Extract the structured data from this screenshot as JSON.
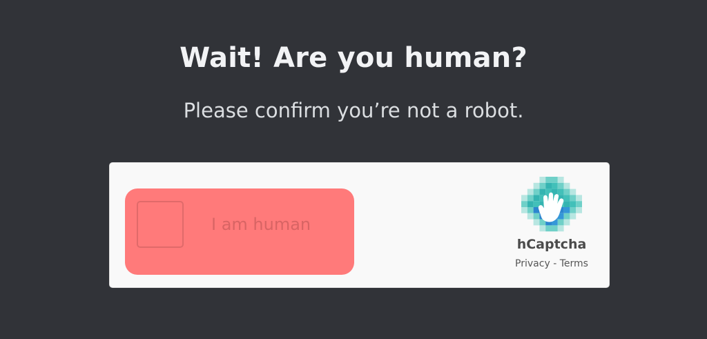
{
  "heading": {
    "title": "Wait! Are you human?",
    "subtitle": "Please confirm you’re not a robot."
  },
  "captcha": {
    "checkbox_label": "I am human",
    "checked": false,
    "brand_name": "hCaptcha",
    "privacy_label": "Privacy",
    "separator": " - ",
    "terms_label": "Terms",
    "logo_icon": "hcaptcha-hand-icon"
  },
  "colors": {
    "background": "#313338",
    "title_text": "#f2f3f5",
    "subtitle_text": "#dbdee1",
    "widget_background": "#f9f9f9",
    "highlight": "#ff7a7a",
    "checkbox_border": "#e06a6a",
    "label_text": "#d86464"
  }
}
